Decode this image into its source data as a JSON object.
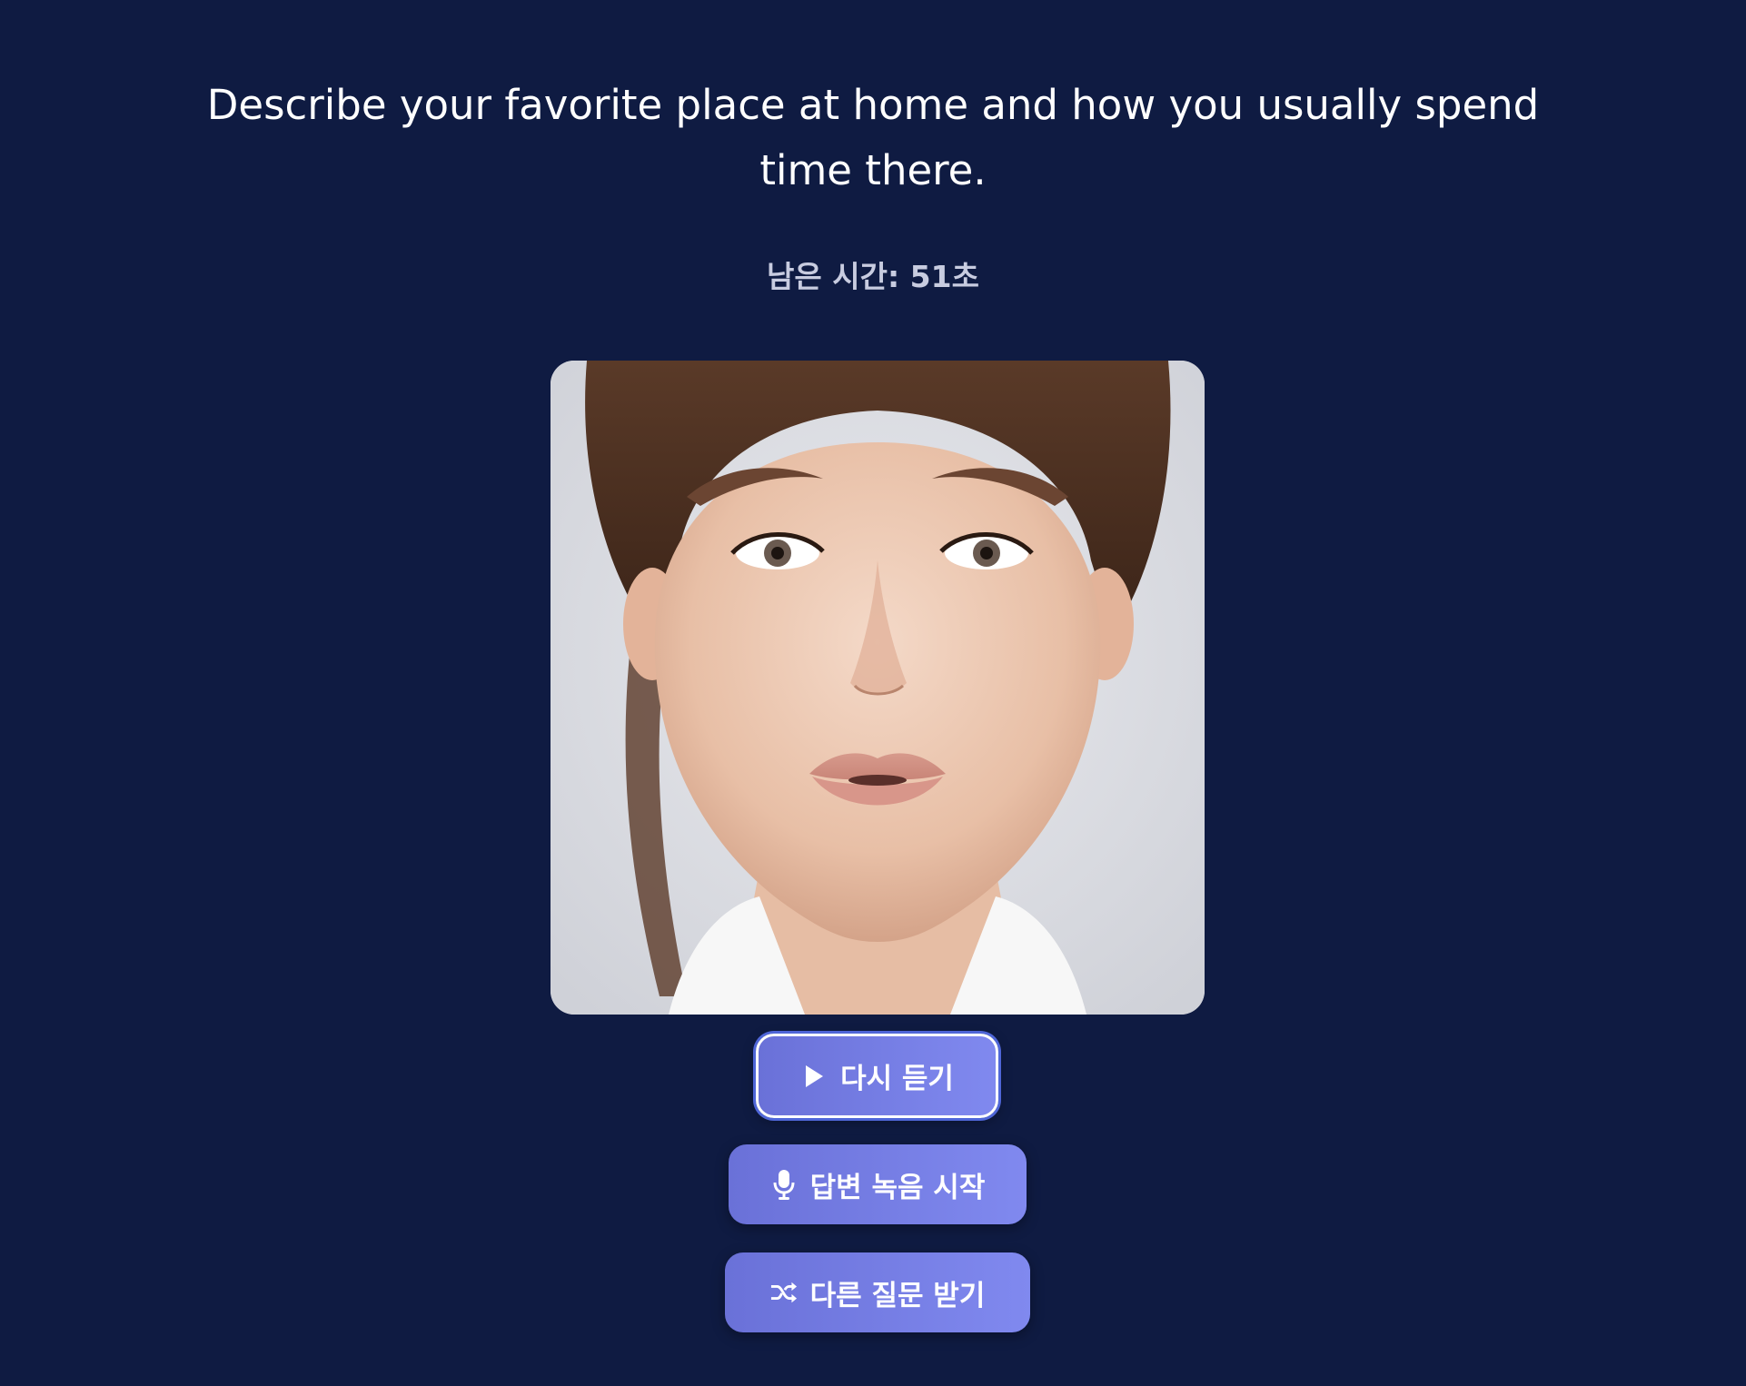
{
  "question": {
    "text": "Describe your favorite place at home and how you usually spend time there."
  },
  "timer": {
    "text": "남은 시간: 51초"
  },
  "avatar": {
    "description_icon": "speaking-avatar-video"
  },
  "buttons": {
    "replay": {
      "label": "다시 듣기",
      "icon": "play-icon"
    },
    "record": {
      "label": "답변 녹음 시작",
      "icon": "microphone-icon"
    },
    "shuffle": {
      "label": "다른 질문 받기",
      "icon": "shuffle-icon"
    }
  },
  "colors": {
    "background": "#0f1b42",
    "button_start": "#6a71d8",
    "button_end": "#8089ef",
    "timer_text": "#c8cce0"
  }
}
